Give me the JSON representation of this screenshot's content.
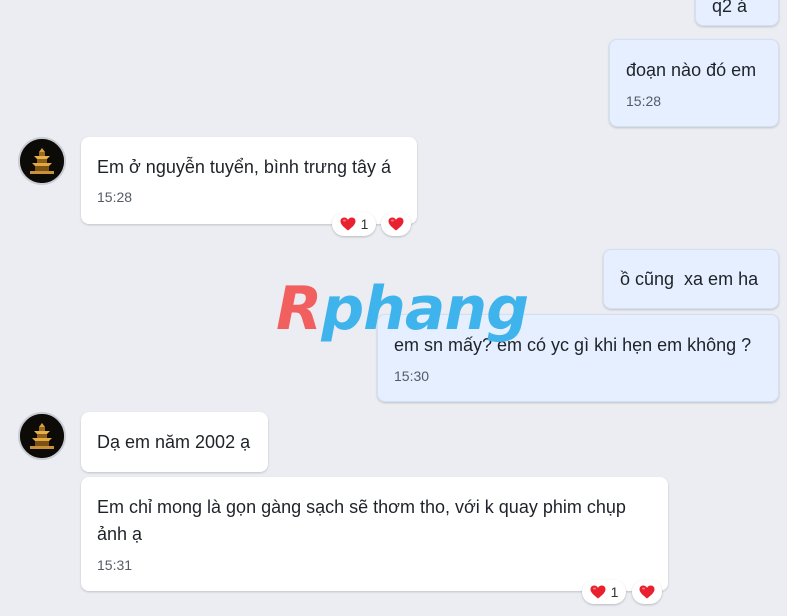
{
  "messages": [
    {
      "id": "m1",
      "direction": "out",
      "text": "q2 á",
      "time": ""
    },
    {
      "id": "m2",
      "direction": "out",
      "text": "đoạn nào đó em",
      "time": "15:28"
    },
    {
      "id": "m3",
      "direction": "in",
      "text": "Em ở nguyễn tuyển, bình trưng tây á",
      "time": "15:28",
      "reaction_count": "1"
    },
    {
      "id": "m4",
      "direction": "out",
      "text": "ồ cũng  xa em ha",
      "time": ""
    },
    {
      "id": "m5",
      "direction": "out",
      "text": "em sn mấy? em có yc gì khi hẹn em không ?",
      "time": "15:30"
    },
    {
      "id": "m6",
      "direction": "in",
      "text": "Dạ em năm 2002 ạ",
      "time": ""
    },
    {
      "id": "m7",
      "direction": "in",
      "text": "Em chỉ mong là gọn gàng sạch sẽ thơm tho, với k quay phim chụp ảnh ạ",
      "time": "15:31",
      "reaction_count": "1"
    }
  ],
  "watermark": {
    "first": "R",
    "rest": "phang"
  },
  "icons": {
    "reaction": "heart-icon",
    "avatar": "contact-avatar"
  },
  "colors": {
    "outgoing_bubble": "#e5efff",
    "incoming_bubble": "#ffffff",
    "background": "#ebedf2",
    "heart": "#e8202f"
  }
}
